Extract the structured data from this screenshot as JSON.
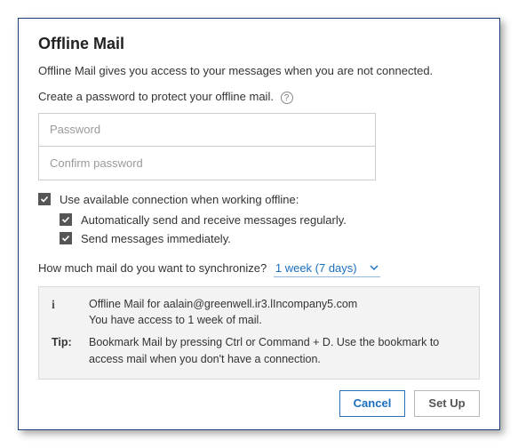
{
  "title": "Offline Mail",
  "intro": "Offline Mail gives you access to your messages when you are not connected.",
  "password_section": {
    "label": "Create a password to protect your offline mail.",
    "password_placeholder": "Password",
    "confirm_placeholder": "Confirm password"
  },
  "checkboxes": {
    "use_connection": "Use available connection when working offline:",
    "auto_send_receive": "Automatically send and receive messages regularly.",
    "send_immediately": "Send messages immediately."
  },
  "sync": {
    "question": "How much mail do you want to synchronize?",
    "selected": "1 week (7 days)"
  },
  "info": {
    "line1": "Offline Mail for aalain@greenwell.ir3.lIncompany5.com",
    "line2": "You have access to 1 week of mail.",
    "tip_label": "Tip:",
    "tip_body": "Bookmark Mail by pressing Ctrl or Command + D. Use the bookmark to access mail when you don't have a connection."
  },
  "buttons": {
    "cancel": "Cancel",
    "setup": "Set Up"
  }
}
